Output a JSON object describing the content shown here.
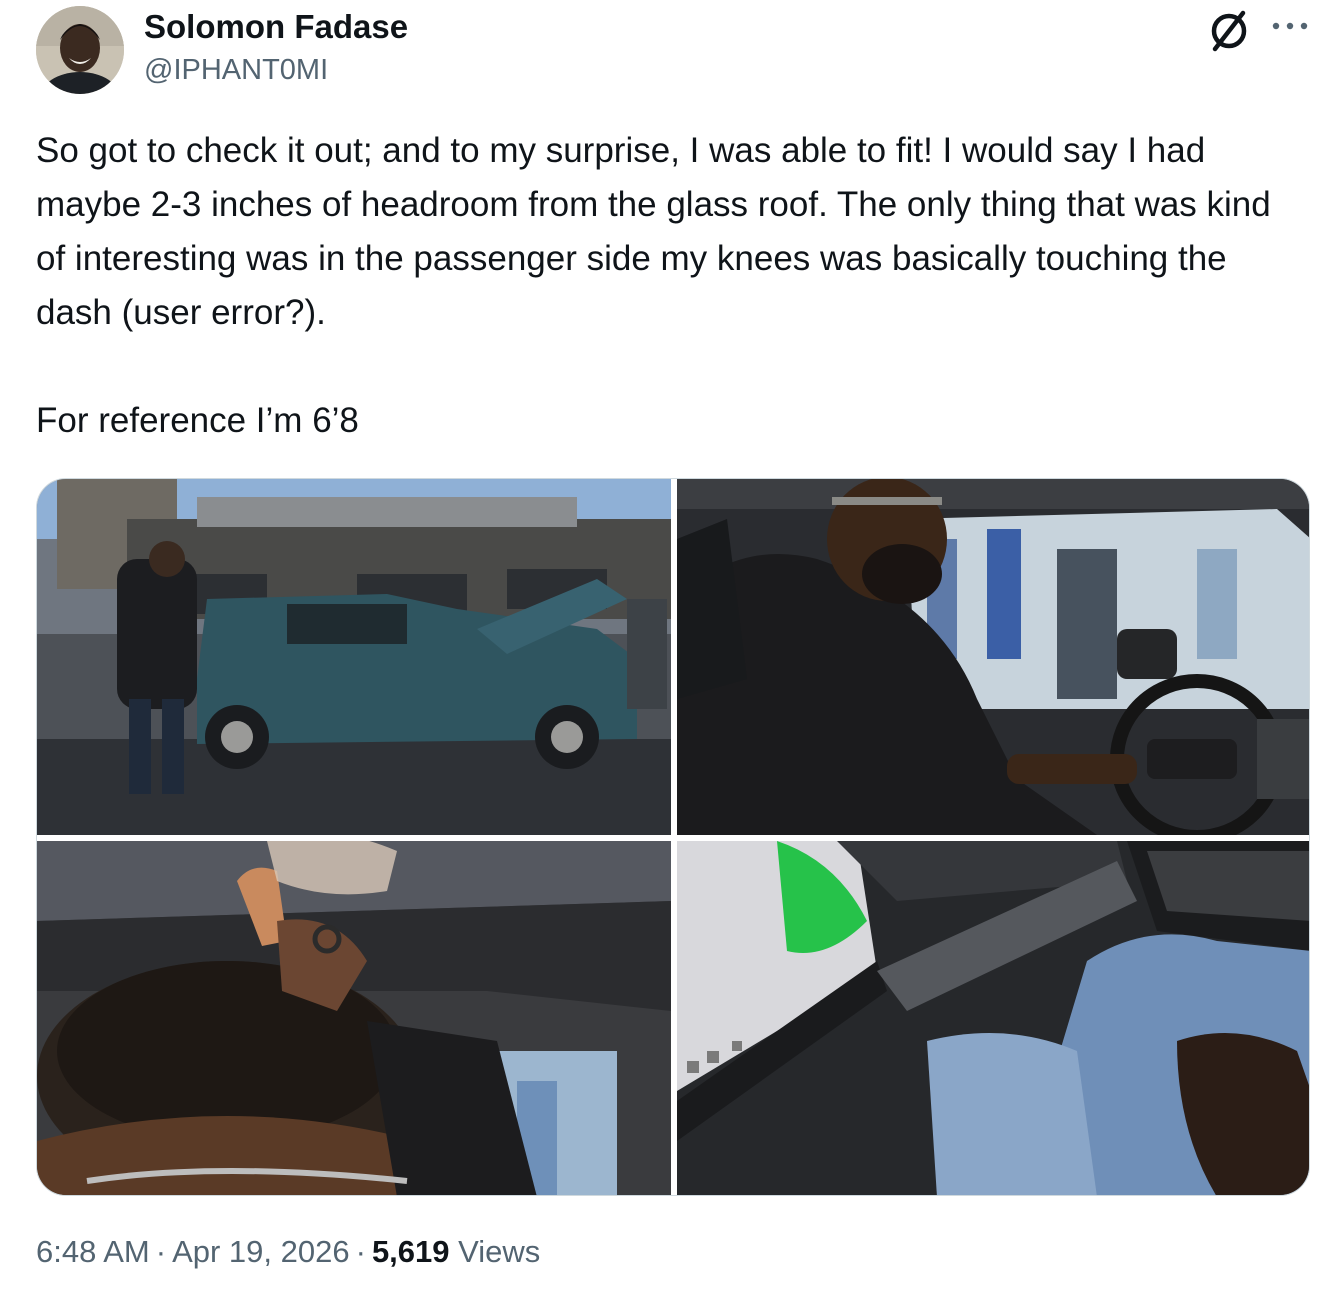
{
  "author": {
    "display_name": "Solomon Fadase",
    "handle": "@IPHANT0MI",
    "avatar_icon": "profile-photo"
  },
  "header_icons": [
    "brand-logo-icon",
    "more-options-icon"
  ],
  "tweet": {
    "paragraphs": [
      "So got to check it out; and to my surprise, I was able to fit! I would say I had maybe 2-3 inches of headroom from the glass roof. The only thing that was kind of interesting was in the passenger side my knees was basically touching the dash (user error?).",
      "For reference I’m 6’8"
    ]
  },
  "media": {
    "count": 4,
    "images": [
      "photo-man-beside-suv",
      "photo-driver-seat",
      "photo-headroom-glass-roof",
      "photo-knees-dashboard"
    ]
  },
  "meta": {
    "time": "6:48 AM",
    "separator": "·",
    "date": "Apr 19, 2026",
    "views_count": "5,619",
    "views_label": "Views"
  },
  "colors": {
    "text_primary": "#0f1419",
    "text_secondary": "#536471",
    "border": "#cfd9de"
  }
}
